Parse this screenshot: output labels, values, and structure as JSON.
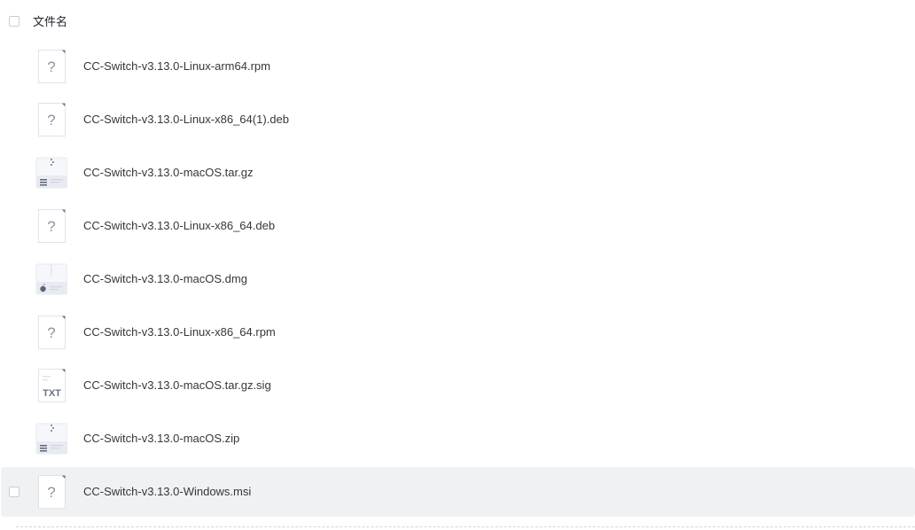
{
  "header": {
    "column_label": "文件名"
  },
  "files": [
    {
      "name": "CC-Switch-v3.13.0-Linux-arm64.rpm",
      "icon": "unknown-file-icon"
    },
    {
      "name": "CC-Switch-v3.13.0-Linux-x86_64(1).deb",
      "icon": "unknown-file-icon"
    },
    {
      "name": "CC-Switch-v3.13.0-macOS.tar.gz",
      "icon": "archive-file-icon"
    },
    {
      "name": "CC-Switch-v3.13.0-Linux-x86_64.deb",
      "icon": "unknown-file-icon"
    },
    {
      "name": "CC-Switch-v3.13.0-macOS.dmg",
      "icon": "dmg-file-icon"
    },
    {
      "name": "CC-Switch-v3.13.0-Linux-x86_64.rpm",
      "icon": "unknown-file-icon"
    },
    {
      "name": "CC-Switch-v3.13.0-macOS.tar.gz.sig",
      "icon": "txt-file-icon"
    },
    {
      "name": "CC-Switch-v3.13.0-macOS.zip",
      "icon": "archive-file-icon"
    },
    {
      "name": "CC-Switch-v3.13.0-Windows.msi",
      "icon": "unknown-file-icon"
    }
  ],
  "icon_labels": {
    "txt": "TXT",
    "unknown": "?"
  },
  "colors": {
    "row_hover_bg": "#f0f1f3",
    "icon_paper": "#f5f7fb",
    "icon_outline": "#dfe3ea",
    "icon_glyph": "#8c93a3",
    "icon_corner": "#5b6b8c"
  }
}
